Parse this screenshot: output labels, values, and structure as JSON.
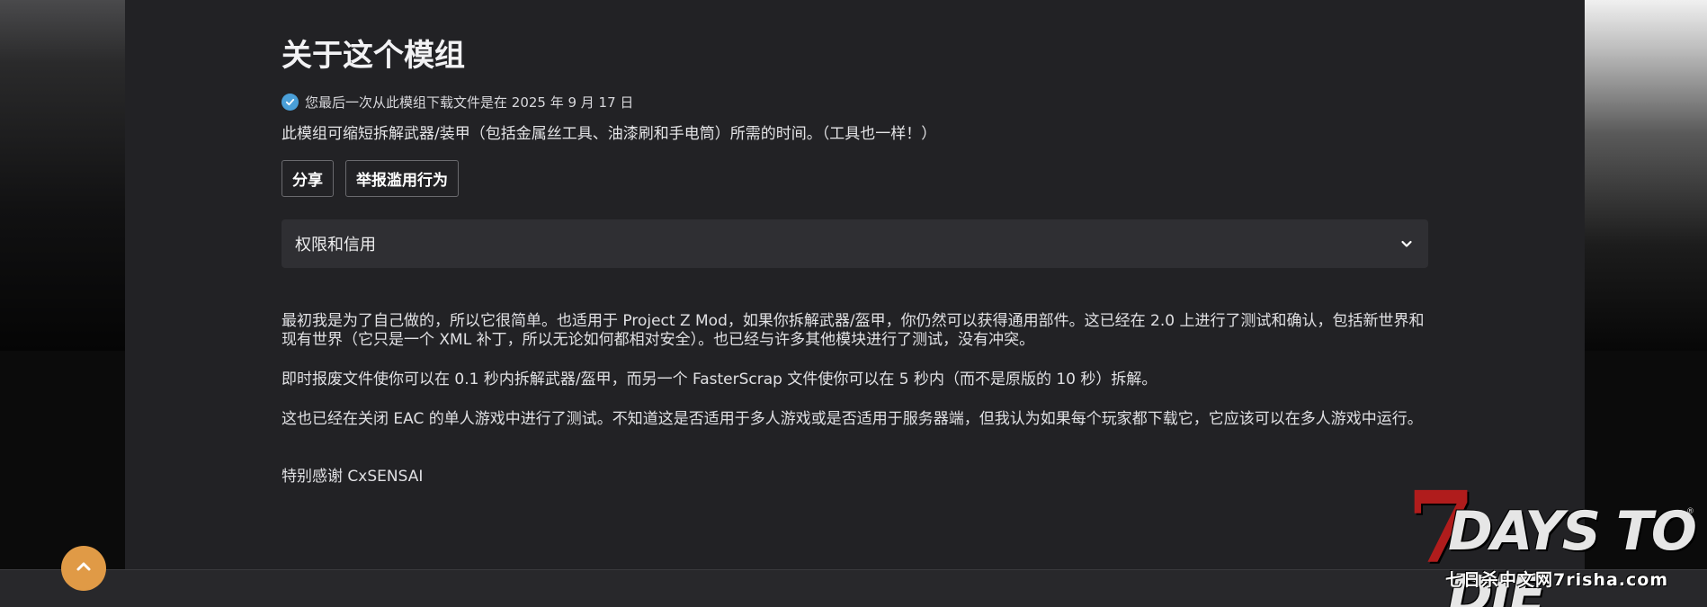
{
  "about": {
    "title": "关于这个模组",
    "download_notice": "您最后一次从此模组下载文件是在 2025 年 9 月 17 日",
    "summary": "此模组可缩短拆解武器/装甲（包括金属丝工具、油漆刷和手电筒）所需的时间。（工具也一样！）"
  },
  "buttons": {
    "share_label": "分享",
    "report_label": "举报滥用行为"
  },
  "accordion": {
    "label": "权限和信用"
  },
  "description": {
    "paragraphs": [
      "最初我是为了自己做的，所以它很简单。也适用于 Project Z Mod，如果你拆解武器/盔甲，你仍然可以获得通用部件。这已经在 2.0 上进行了测试和确认，包括新世界和现有世界（它只是一个 XML 补丁，所以无论如何都相对安全）。也已经与许多其他模块进行了测试，没有冲突。",
      "即时报废文件使你可以在 0.1 秒内拆解武器/盔甲，而另一个 FasterScrap 文件使你可以在 5 秒内（而不是原版的 10 秒）拆解。",
      "这也已经在关闭 EAC 的单人游戏中进行了测试。不知道这是否适用于多人游戏或是否适用于服务器端，但我认为如果每个玩家都下载它，它应该可以在多人游戏中运行。"
    ],
    "thanks": "特别感谢 CxSENSAI"
  },
  "watermark": {
    "seven": "7",
    "main": "DAYS TO DIE",
    "reg": "®",
    "sub": "七日杀中文网7risha.com"
  },
  "colors": {
    "panel_bg": "#222225",
    "accent_blue": "#4a9fd8",
    "scroll_button": "#e09a46",
    "logo_red": "#b01c1c"
  },
  "icons": {
    "download_status": "check-circle-icon",
    "accordion_toggle": "chevron-down-icon",
    "scroll_top": "chevron-up-icon"
  }
}
